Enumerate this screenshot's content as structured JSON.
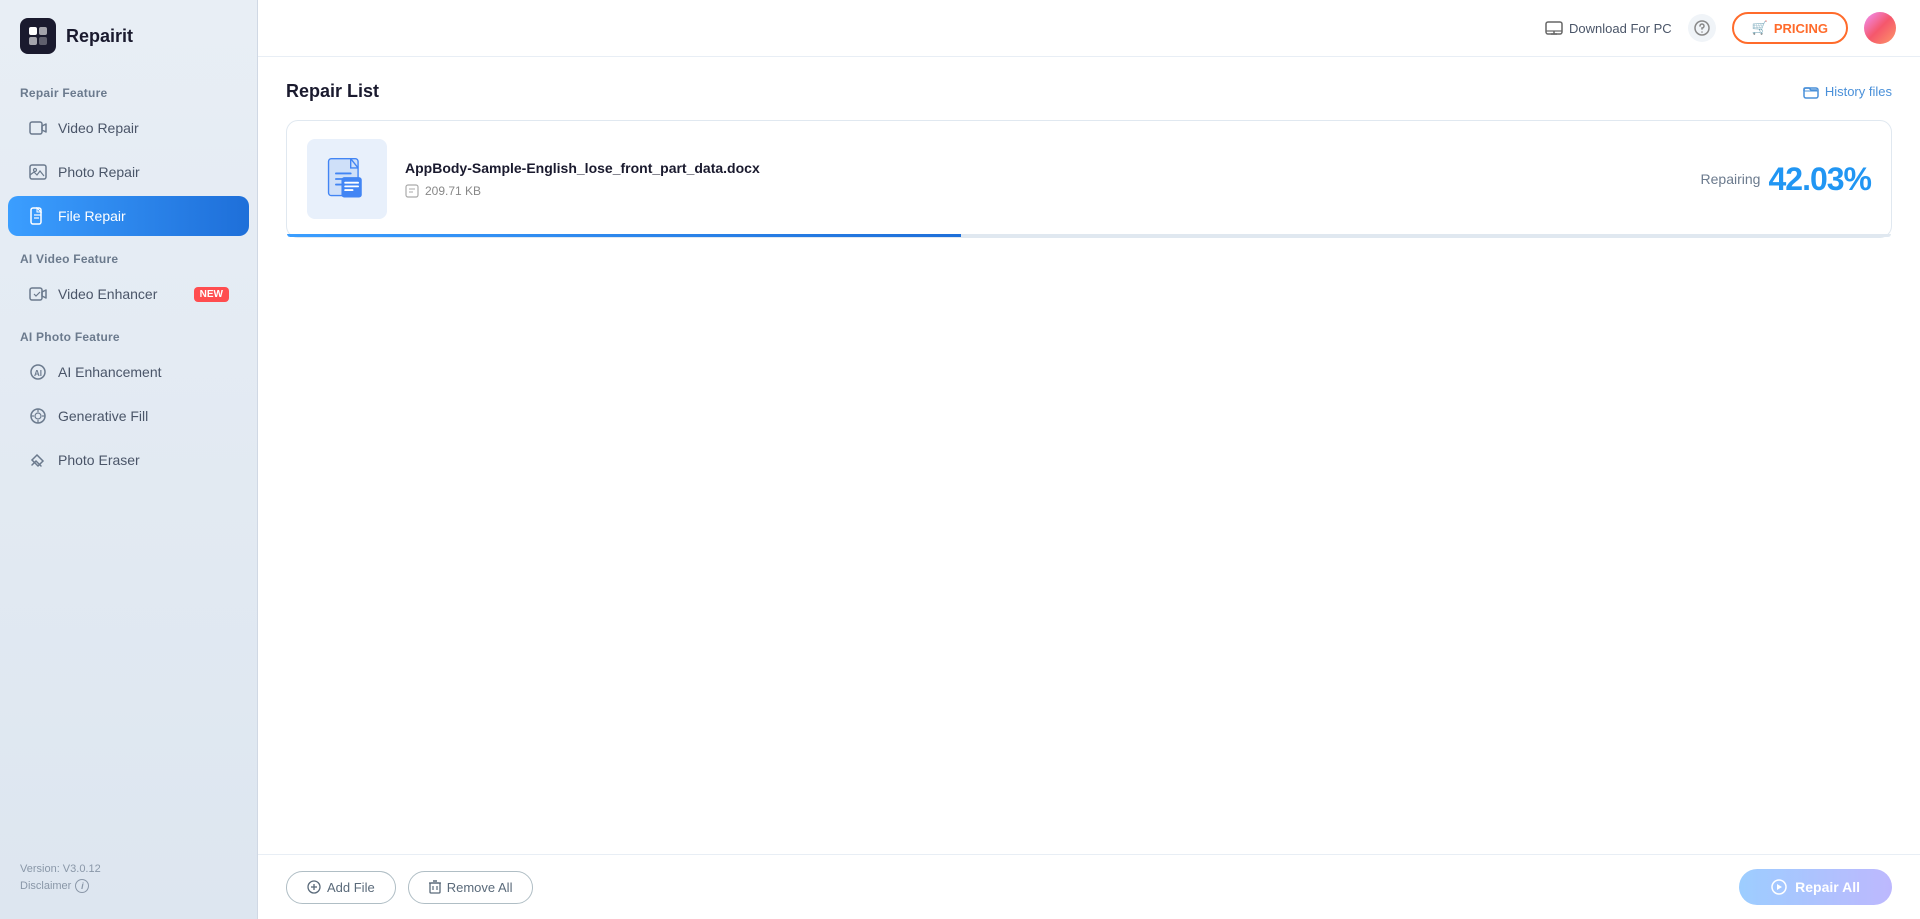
{
  "app": {
    "name": "Repairit",
    "logo_symbol": "▶"
  },
  "topbar": {
    "download_for_pc": "Download For PC",
    "pricing_label": "PRICING",
    "pricing_icon": "🛒"
  },
  "sidebar": {
    "repair_feature_label": "Repair Feature",
    "video_repair_label": "Video Repair",
    "photo_repair_label": "Photo Repair",
    "file_repair_label": "File Repair",
    "ai_video_feature_label": "AI Video Feature",
    "video_enhancer_label": "Video Enhancer",
    "video_enhancer_badge": "NEW",
    "ai_photo_feature_label": "AI Photo Feature",
    "ai_enhancement_label": "AI Enhancement",
    "generative_fill_label": "Generative Fill",
    "photo_eraser_label": "Photo Eraser",
    "version": "Version: V3.0.12",
    "disclaimer": "Disclaimer"
  },
  "main": {
    "repair_list_title": "Repair List",
    "history_files_label": "History files"
  },
  "file_card": {
    "file_name": "AppBody-Sample-English_lose_front_part_data.docx",
    "file_size": "209.71 KB",
    "repairing_label": "Repairing",
    "progress_percent": "42.03%",
    "progress_value": 42.03
  },
  "bottombar": {
    "add_file_label": "Add File",
    "remove_all_label": "Remove All",
    "repair_all_label": "Repair All"
  }
}
